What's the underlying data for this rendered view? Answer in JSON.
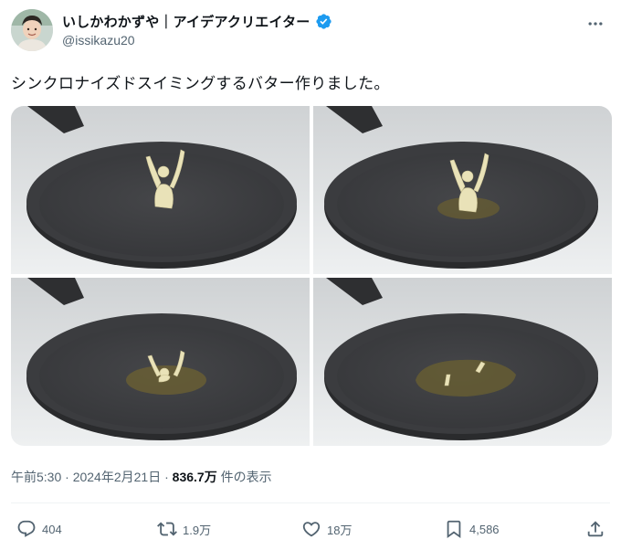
{
  "author": {
    "display_name": "いしかわかずや｜アイデアクリエイター",
    "handle": "@issikazu20",
    "verified": true
  },
  "tweet": {
    "text": "シンクロナイズドスイミングするバター作りました。"
  },
  "media": {
    "panels": [
      {
        "stage": "butter-figure-standing"
      },
      {
        "stage": "butter-figure-melting-slightly"
      },
      {
        "stage": "butter-figure-half-melted"
      },
      {
        "stage": "butter-melted-pool-with-hands"
      }
    ]
  },
  "meta": {
    "time": "午前5:30",
    "separator": "·",
    "date": "2024年2月21日",
    "views_count": "836.7万",
    "views_label": "件の表示"
  },
  "actions": {
    "replies": "404",
    "retweets": "1.9万",
    "likes": "18万",
    "bookmarks": "4,586"
  },
  "icons": {
    "more": "more-horizontal-icon",
    "reply": "reply-icon",
    "retweet": "retweet-icon",
    "like": "heart-icon",
    "bookmark": "bookmark-icon",
    "share": "share-icon",
    "verified": "verified-badge-icon"
  },
  "colors": {
    "text": "#0f1419",
    "secondary": "#536471",
    "verified": "#1d9bf0",
    "divider": "#eff3f4"
  }
}
